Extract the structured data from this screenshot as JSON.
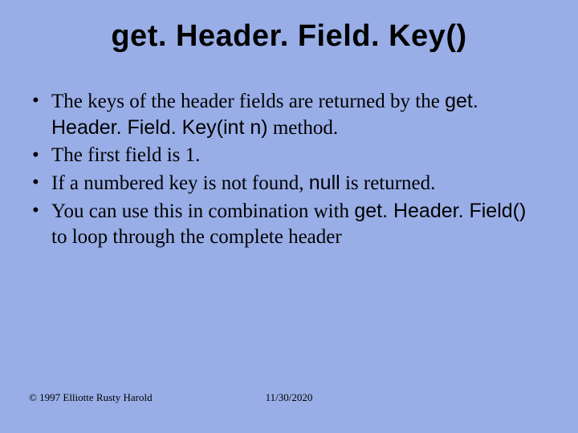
{
  "title": "get. Header. Field. Key()",
  "bullets": {
    "b1_a": "The keys of the header fields are returned by the ",
    "b1_b": "get. Header. Field. Key(int n)",
    "b1_c": " method.",
    "b2": "The first field is 1.",
    "b3_a": "If a numbered key is not found, ",
    "b3_b": "null",
    "b3_c": " is returned.",
    "b4_a": "You can use this in combination with ",
    "b4_b": "get. Header. Field()",
    "b4_c": " to loop through the complete header"
  },
  "footer": {
    "copyright": "© 1997 Elliotte Rusty Harold",
    "date": "11/30/2020"
  }
}
